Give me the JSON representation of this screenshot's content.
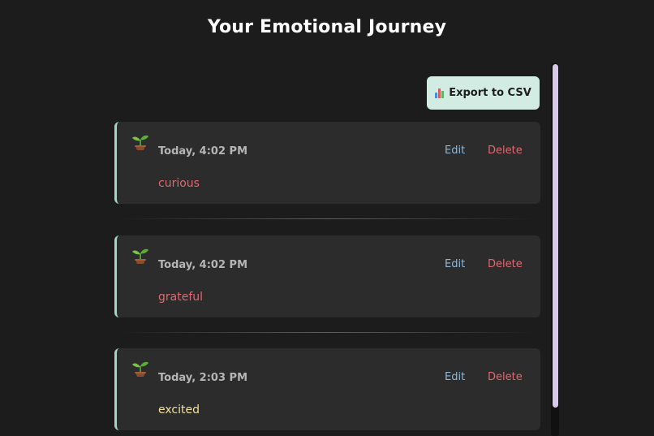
{
  "header": {
    "title": "Your Emotional Journey"
  },
  "toolbar": {
    "export_label": "Export to CSV",
    "export_icon": "bar-chart-icon"
  },
  "entries": [
    {
      "time": "Today, 4:02 PM",
      "emotion": "curious",
      "emotion_color": "#e06870",
      "edit_label": "Edit",
      "delete_label": "Delete",
      "icon": "sprout-icon"
    },
    {
      "time": "Today, 4:02 PM",
      "emotion": "grateful",
      "emotion_color": "#e06870",
      "edit_label": "Edit",
      "delete_label": "Delete",
      "icon": "sprout-icon"
    },
    {
      "time": "Today, 2:03 PM",
      "emotion": "excited",
      "emotion_color": "#f2e0a0",
      "edit_label": "Edit",
      "delete_label": "Delete",
      "icon": "sprout-icon"
    }
  ],
  "colors": {
    "background": "#1c1c1c",
    "card": "#2c2c2c",
    "accent": "#9fd6c0",
    "export_button": "#d2ece4",
    "edit": "#8fb8d8",
    "delete": "#e06870",
    "scrollbar": "#d8c8ec"
  }
}
